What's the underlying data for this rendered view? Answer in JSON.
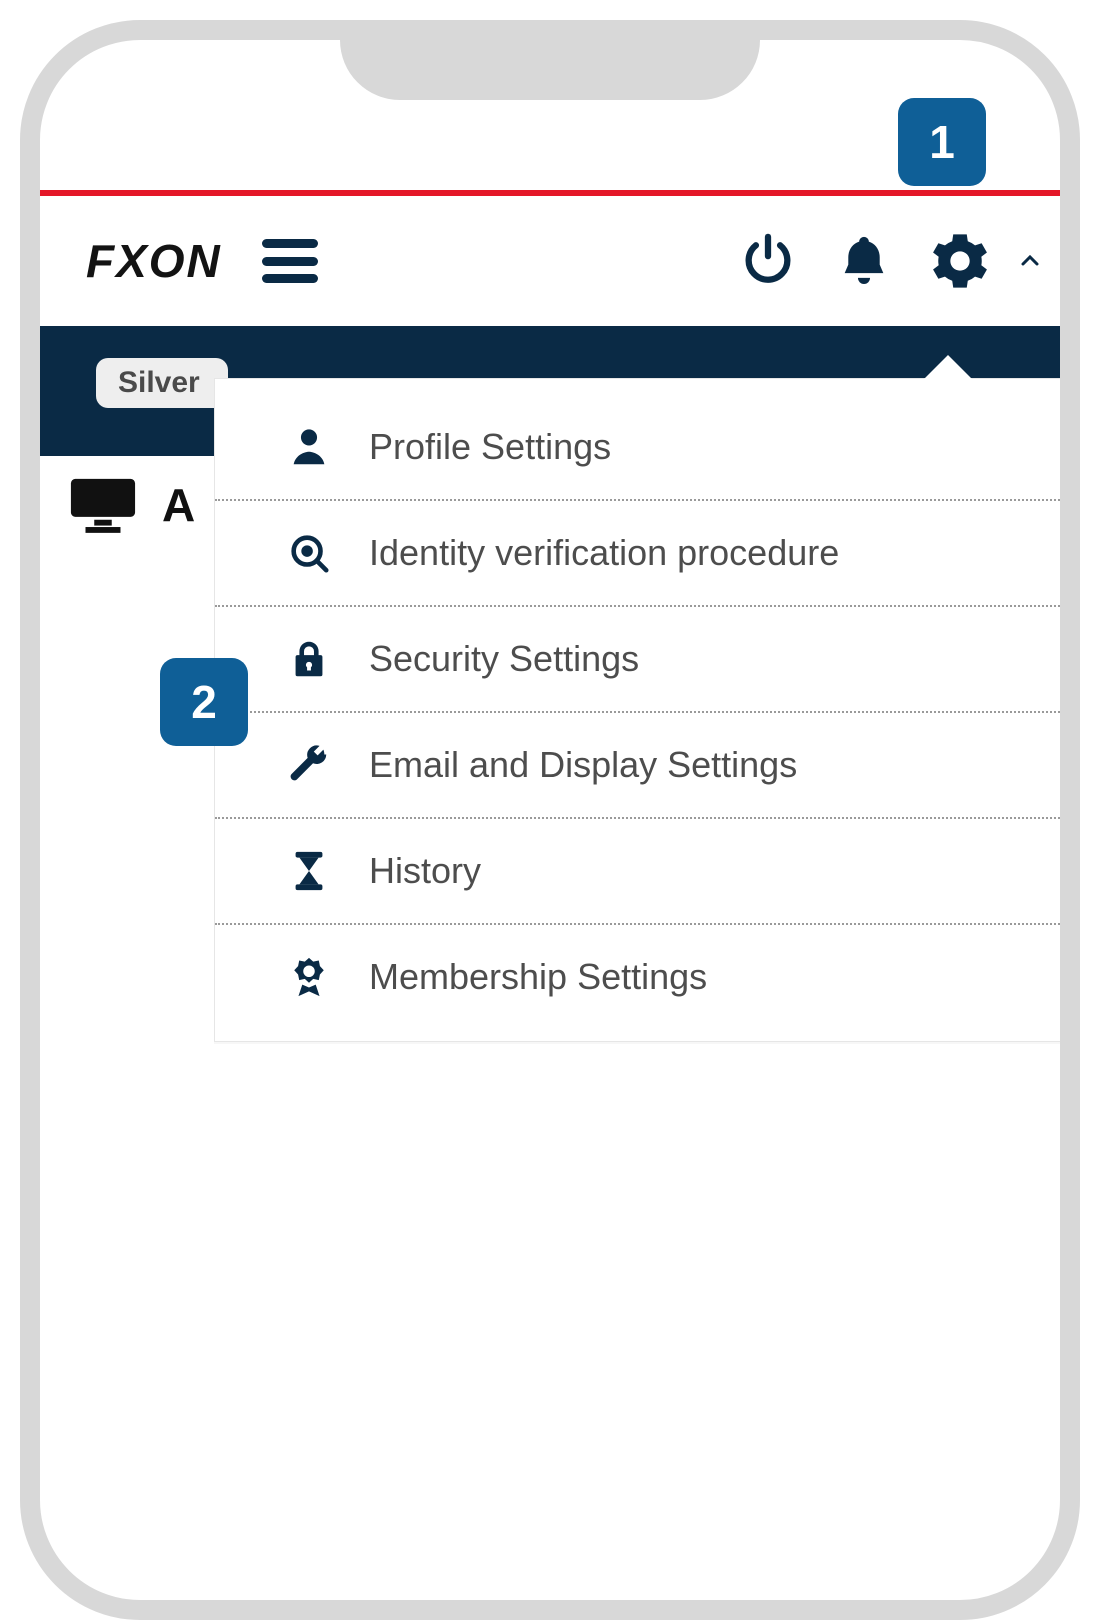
{
  "brand": {
    "name": "FXON"
  },
  "header": {
    "badge_status": "Silver",
    "section_letter": "A"
  },
  "step_badges": {
    "one": "1",
    "two": "2"
  },
  "dropdown": {
    "items": [
      {
        "label": "Profile Settings"
      },
      {
        "label": "Identity verification procedure"
      },
      {
        "label": "Security Settings"
      },
      {
        "label": "Email and Display Settings"
      },
      {
        "label": "History"
      },
      {
        "label": "Membership Settings"
      }
    ]
  }
}
